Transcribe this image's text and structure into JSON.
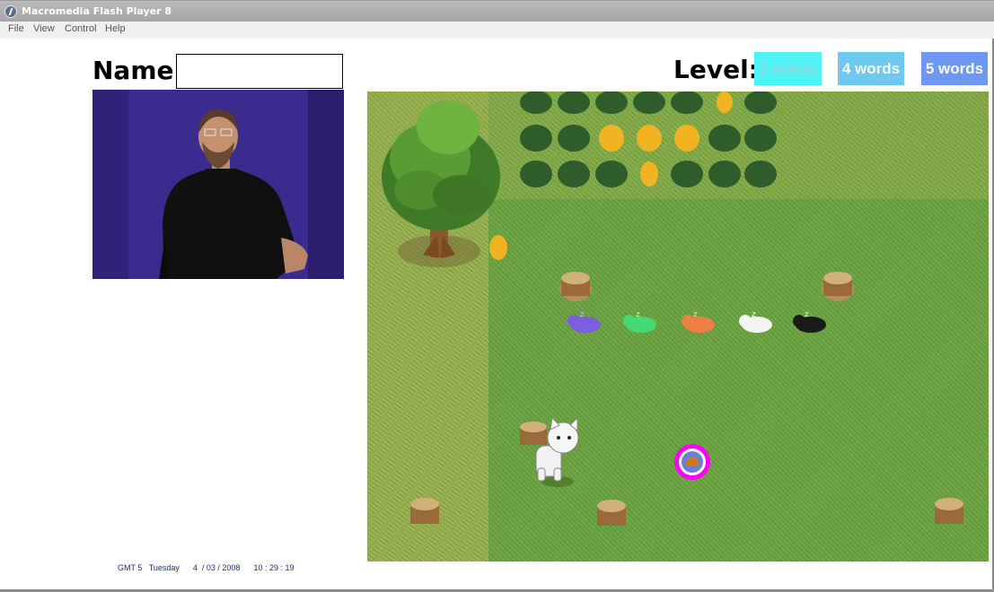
{
  "window": {
    "title": "Macromedia Flash Player 8"
  },
  "menu": [
    "File",
    "View",
    "Control",
    "Help"
  ],
  "name_form": {
    "label": "Name:",
    "value": ""
  },
  "level": {
    "label": "Level:",
    "options": [
      "3 words",
      "4 words",
      "5 words"
    ]
  },
  "game": {
    "cats": [
      "purple",
      "green",
      "orange",
      "white",
      "black"
    ]
  },
  "status": {
    "timezone": "GMT 5",
    "day": "Tuesday",
    "date": "4  / 03 / 2008",
    "time": "10 : 29 : 19"
  },
  "colors": {
    "level_3": "#4ff3f7",
    "level_4": "#6ec8ef",
    "level_5": "#6d97f0",
    "grass": "#67a23a",
    "video_bg": "#3a2a8c"
  }
}
